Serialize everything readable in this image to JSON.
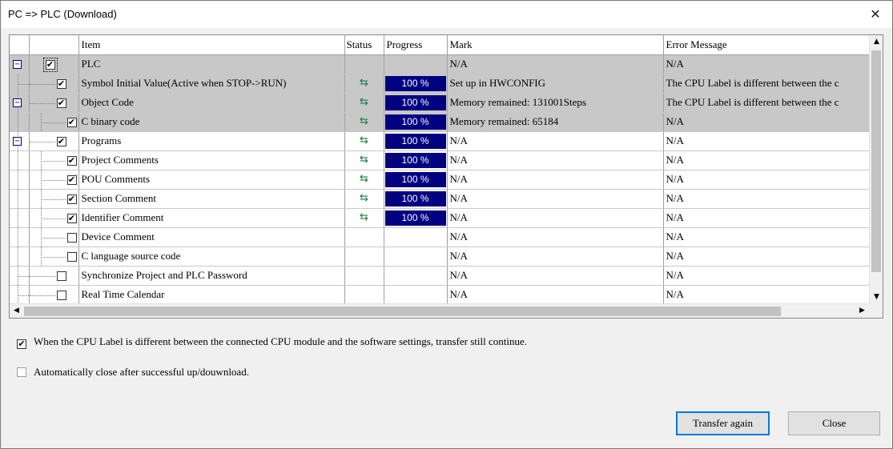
{
  "window": {
    "title": "PC => PLC (Download)",
    "close_label": "✕"
  },
  "grid": {
    "columns": {
      "item": "Item",
      "status": "Status",
      "progress": "Progress",
      "mark": "Mark",
      "error": "Error Message"
    },
    "rows": [
      {
        "level": 0,
        "expander": "−",
        "checked": "✔",
        "item": "PLC",
        "status_icon": "",
        "progress": "",
        "mark": "N/A",
        "error": "N/A",
        "gray": true
      },
      {
        "level": 1,
        "expander": "",
        "checked": "✔",
        "item": "Symbol Initial Value(Active when STOP->RUN)",
        "status_icon": "⇆",
        "progress": "100 %",
        "mark": "Set up in HWCONFIG",
        "error": "The CPU Label is different between the c",
        "gray": true
      },
      {
        "level": 1,
        "expander": "−",
        "checked": "✔",
        "item": "Object Code",
        "status_icon": "⇆",
        "progress": "100 %",
        "mark": "Memory remained: 131001Steps",
        "error": "The CPU Label is different between the c",
        "gray": true
      },
      {
        "level": 2,
        "expander": "",
        "checked": "✔",
        "item": "C binary code",
        "status_icon": "⇆",
        "progress": "100 %",
        "mark": "Memory remained: 65184",
        "error": "N/A",
        "gray": true
      },
      {
        "level": 1,
        "expander": "−",
        "checked": "✔",
        "item": "Programs",
        "status_icon": "⇆",
        "progress": "100 %",
        "mark": "N/A",
        "error": "N/A",
        "gray": false
      },
      {
        "level": 2,
        "expander": "",
        "checked": "✔",
        "item": "Project Comments",
        "status_icon": "⇆",
        "progress": "100 %",
        "mark": "N/A",
        "error": "N/A",
        "gray": false
      },
      {
        "level": 2,
        "expander": "",
        "checked": "✔",
        "item": "POU Comments",
        "status_icon": "⇆",
        "progress": "100 %",
        "mark": "N/A",
        "error": "N/A",
        "gray": false
      },
      {
        "level": 2,
        "expander": "",
        "checked": "✔",
        "item": "Section Comment",
        "status_icon": "⇆",
        "progress": "100 %",
        "mark": "N/A",
        "error": "N/A",
        "gray": false
      },
      {
        "level": 2,
        "expander": "",
        "checked": "✔",
        "item": "Identifier Comment",
        "status_icon": "⇆",
        "progress": "100 %",
        "mark": "N/A",
        "error": "N/A",
        "gray": false
      },
      {
        "level": 2,
        "expander": "",
        "checked": "",
        "item": "Device Comment",
        "status_icon": "",
        "progress": "",
        "mark": "N/A",
        "error": "N/A",
        "gray": false
      },
      {
        "level": 2,
        "expander": "",
        "checked": "",
        "item": "C language source code",
        "status_icon": "",
        "progress": "",
        "mark": "N/A",
        "error": "N/A",
        "gray": false
      },
      {
        "level": 1,
        "expander": "",
        "checked": "",
        "item": "Synchronize Project and PLC Password",
        "status_icon": "",
        "progress": "",
        "mark": "N/A",
        "error": "N/A",
        "gray": false
      },
      {
        "level": 1,
        "expander": "",
        "checked": "",
        "item": "Real Time Calendar",
        "status_icon": "",
        "progress": "",
        "mark": "N/A",
        "error": "N/A",
        "gray": false
      }
    ]
  },
  "scroll": {
    "up": "▲",
    "down": "▼",
    "left": "◀",
    "right": "▶"
  },
  "options": {
    "continue_on_label_diff": {
      "checked": "✔",
      "label": "When the CPU Label is different between the connected CPU module and the software settings, transfer still continue."
    },
    "auto_close": {
      "checked": "",
      "label": "Automatically close after successful up/douwnload."
    }
  },
  "buttons": {
    "transfer_again": "Transfer again",
    "close": "Close"
  },
  "colors": {
    "progress_fill": "#000080",
    "selected_row": "#c8c8c8",
    "status_icon": "#1b7a3a"
  }
}
